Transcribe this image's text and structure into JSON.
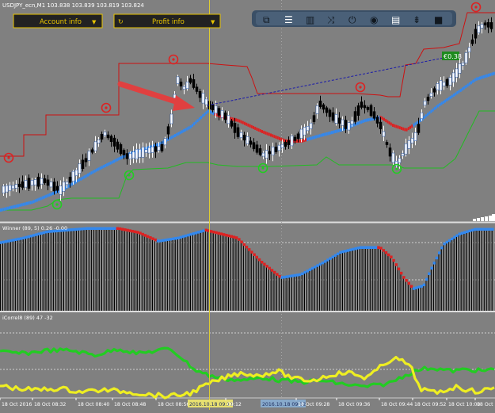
{
  "chart": {
    "symbol_line": "USDJPY_ecn,M1  103.838 103.839 103.819 103.824",
    "price_badge": "€0.38"
  },
  "panels": {
    "account": {
      "label": "Account info",
      "arrow": "▼"
    },
    "profit": {
      "label": "Profit info",
      "arrow": "▼"
    }
  },
  "toolbar": {
    "icons": [
      "window-icon",
      "menu-lines-icon",
      "chart-bars-icon",
      "shuffle-icon",
      "power-icon",
      "eye-icon",
      "trash-icon",
      "scale-icon",
      "camera-icon"
    ]
  },
  "indicators": {
    "winner": "Winner (89, 5)  0.26 -0.00",
    "icorrel": "iCorrel8 (89)  47 -32"
  },
  "time_axis": {
    "labels": [
      "18 Oct 2016",
      "18 Oct 08:32",
      "18 Oct 08:40",
      "18 Oct 08:48",
      "18 Oct 08:56",
      "2016.10.18 09:11",
      "09:12",
      "2016.10.18 09:12",
      "18 Oct 09:28",
      "18 Oct 09:36",
      "18 Oct 09:44",
      "18 Oct 09:52",
      "18 Oct 10:00",
      "18 Oct 10:08"
    ]
  },
  "colors": {
    "background": "#808080",
    "bull": "#ffffff",
    "bear": "#000000",
    "trail_upper": "#cc1111",
    "trail_lower": "#22bb22",
    "trend_blue": "#3388ee",
    "trend_red": "#dd2222",
    "corr_green": "#22cc22",
    "corr_yellow": "#eeee22",
    "cursor": "#ddcc33",
    "panel_fill": "#222222",
    "panel_accent": "#e8c400",
    "toolbar_fill": "#3a4f66",
    "badge_fill": "#1e8a1e"
  }
}
